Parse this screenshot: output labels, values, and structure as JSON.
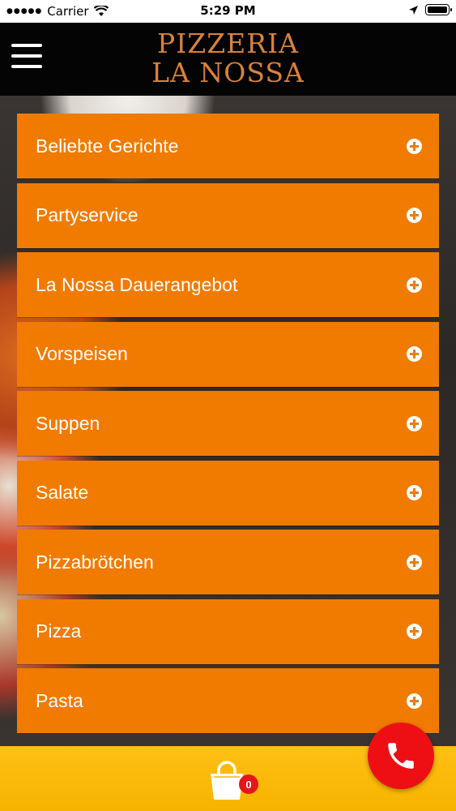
{
  "status_bar": {
    "carrier": "Carrier",
    "time": "5:29 PM"
  },
  "header": {
    "title_line1": "PIZZERIA",
    "title_line2": "LA NOSSA"
  },
  "menu": {
    "items": [
      {
        "label": "Beliebte Gerichte"
      },
      {
        "label": "Partyservice"
      },
      {
        "label": "La Nossa Dauerangebot"
      },
      {
        "label": "Vorspeisen"
      },
      {
        "label": "Suppen"
      },
      {
        "label": "Salate"
      },
      {
        "label": "Pizzabrötchen"
      },
      {
        "label": "Pizza"
      },
      {
        "label": "Pasta"
      }
    ]
  },
  "cart": {
    "count": "0"
  },
  "colors": {
    "accent": "#f07b00",
    "header_bg": "#040404",
    "logo": "#d9823a",
    "cart_bar": "#f7b300",
    "call_button": "#ee0f14"
  },
  "icons": [
    "menu-icon",
    "plus-circle-icon",
    "shopping-bag-icon",
    "phone-icon",
    "wifi-icon",
    "location-arrow-icon",
    "battery-icon"
  ]
}
